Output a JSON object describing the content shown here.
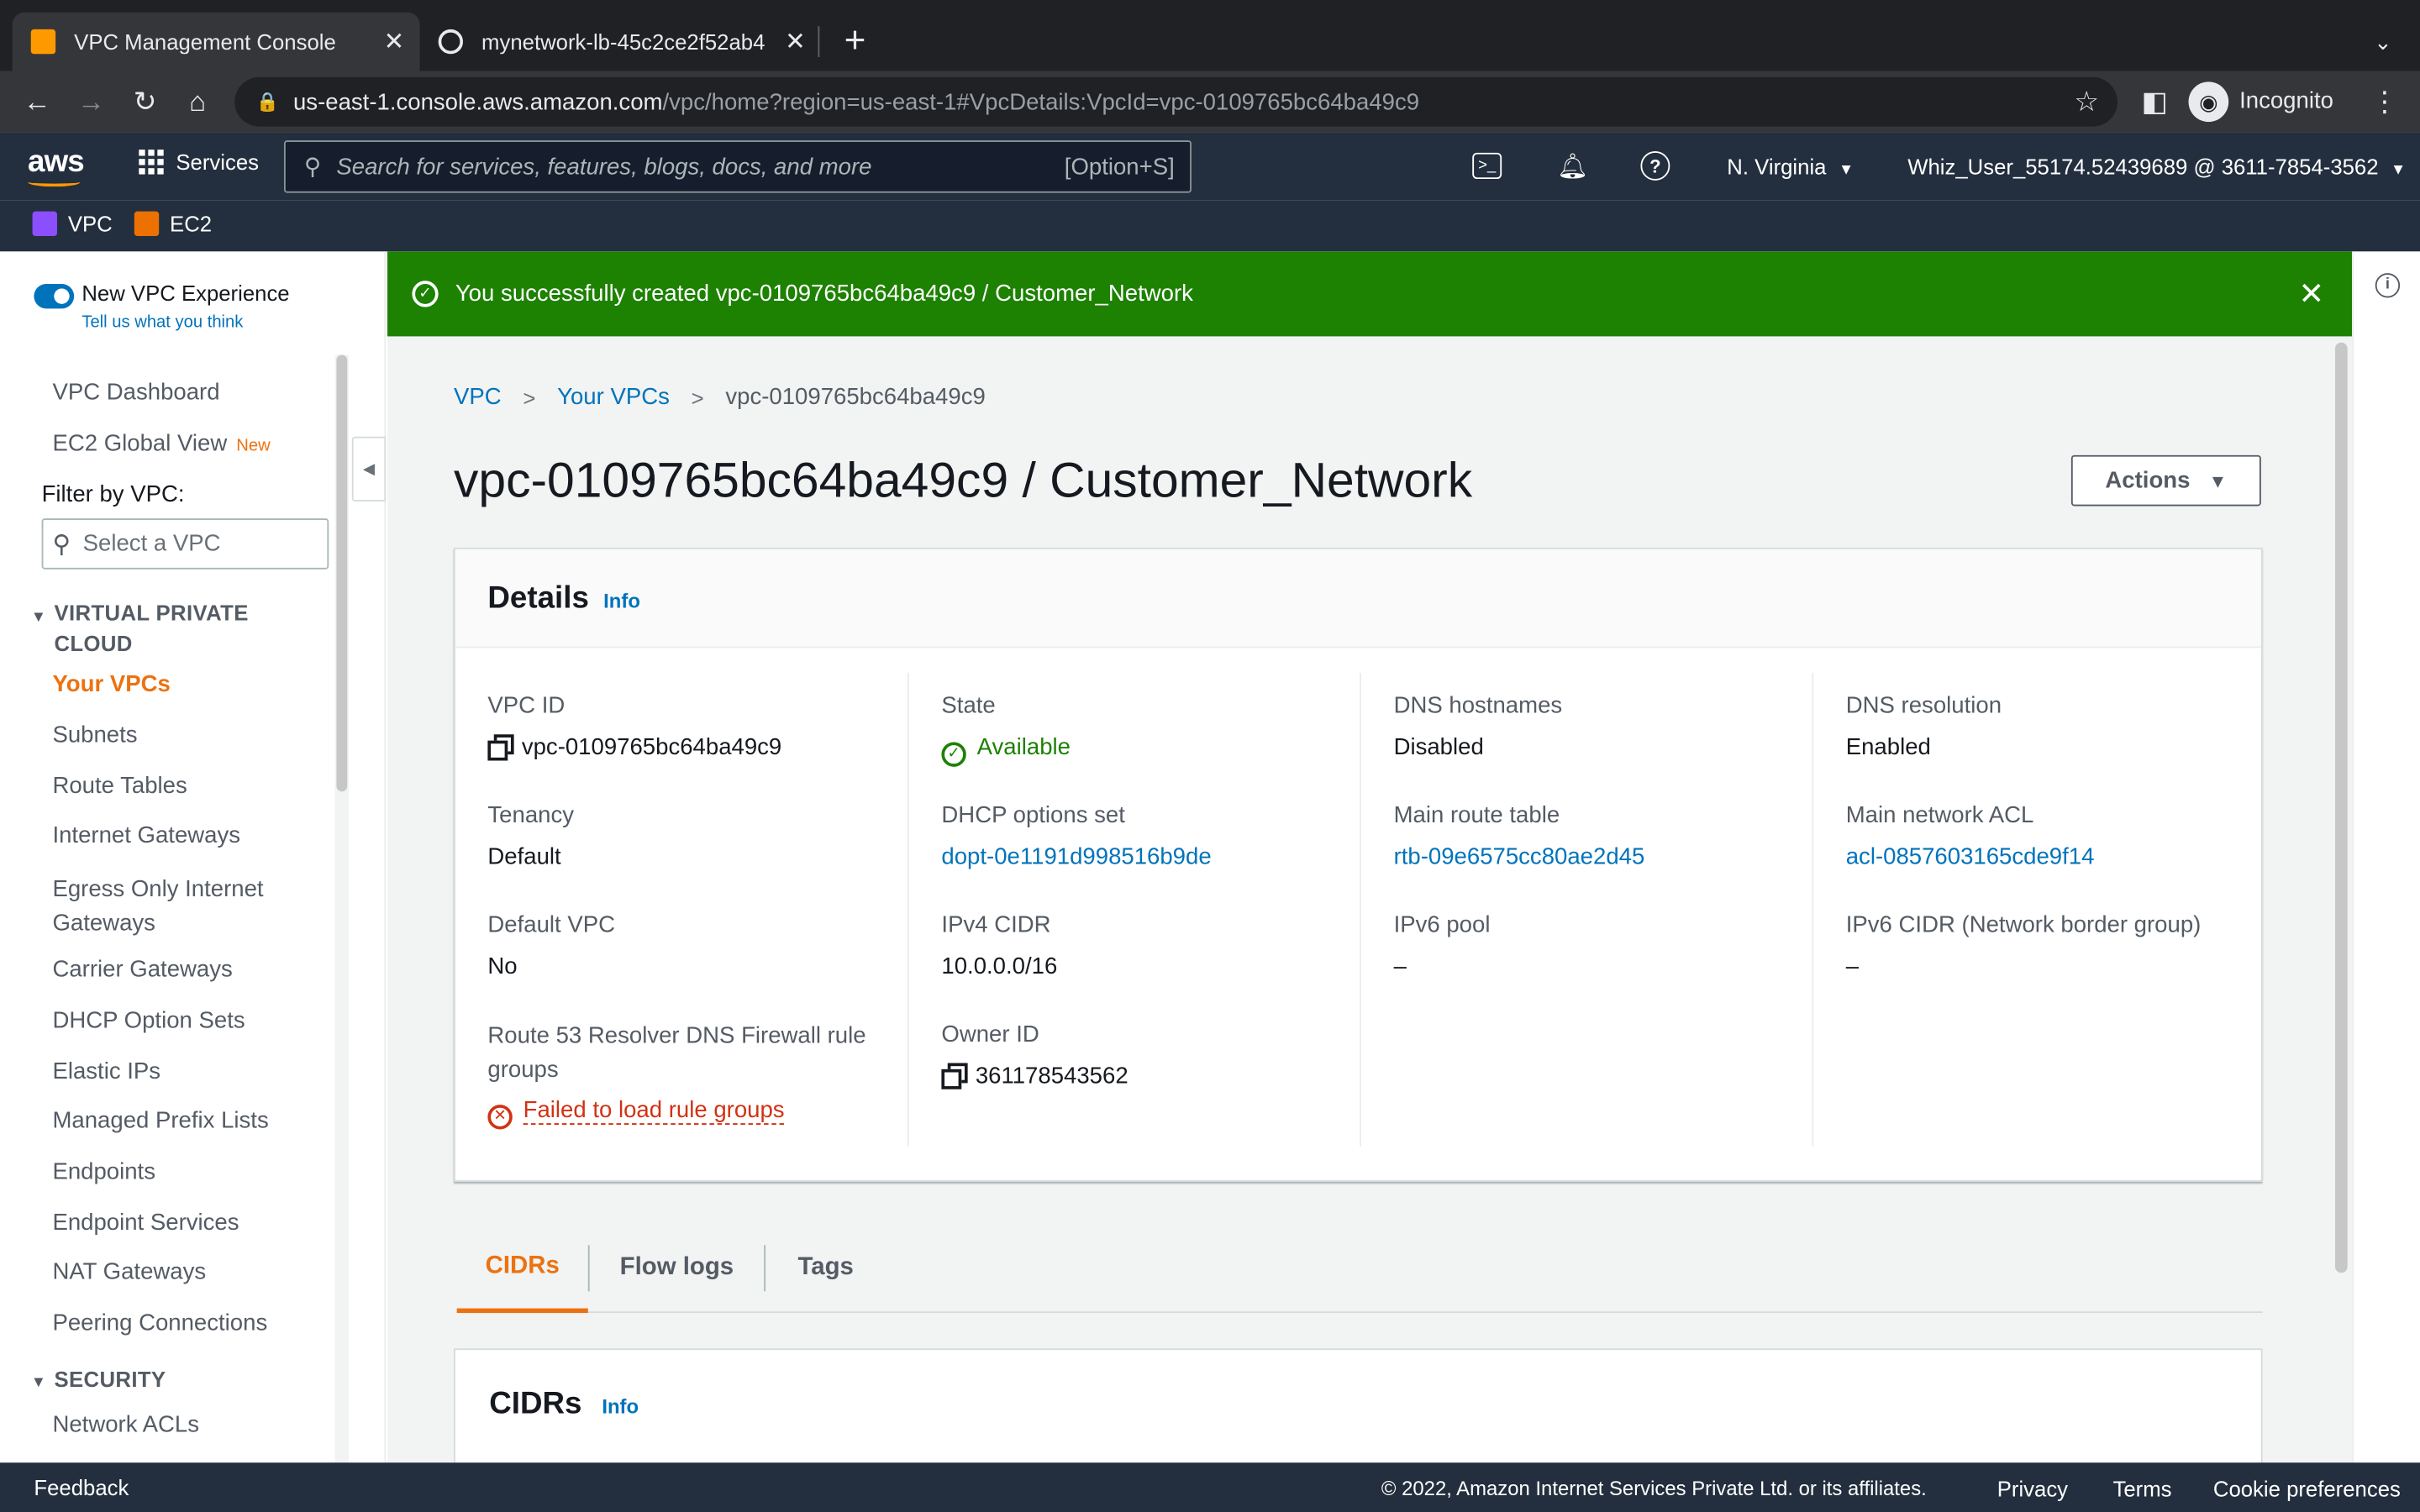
{
  "browser": {
    "tabs": [
      {
        "title": "VPC Management Console",
        "active": true
      },
      {
        "title": "mynetwork-lb-45c2ce2f52ab4",
        "active": false
      }
    ],
    "new_tab": "+",
    "url_host": "us-east-1.console.aws.amazon.com",
    "url_path": "/vpc/home?region=us-east-1#VpcDetails:VpcId=vpc-0109765bc64ba49c9",
    "profile_label": "Incognito"
  },
  "aws_nav": {
    "logo": "aws",
    "services_label": "Services",
    "search_placeholder": "Search for services, features, blogs, docs, and more",
    "search_shortcut": "[Option+S]",
    "region": "N. Virginia",
    "account": "Whiz_User_55174.52439689 @ 3611-7854-3562"
  },
  "favorites": [
    {
      "label": "VPC",
      "color": "#8c4fff"
    },
    {
      "label": "EC2",
      "color": "#ed7100"
    }
  ],
  "sidebar": {
    "new_experience_label": "New VPC Experience",
    "feedback_link": "Tell us what you think",
    "top_items": [
      {
        "label": "VPC Dashboard"
      },
      {
        "label": "EC2 Global View",
        "badge": "New"
      }
    ],
    "filter_label": "Filter by VPC:",
    "filter_placeholder": "Select a VPC",
    "section_vpc": "VIRTUAL PRIVATE CLOUD",
    "vpc_items": [
      {
        "label": "Your VPCs",
        "active": true
      },
      {
        "label": "Subnets"
      },
      {
        "label": "Route Tables"
      },
      {
        "label": "Internet Gateways"
      },
      {
        "label": "Egress Only Internet Gateways"
      },
      {
        "label": "Carrier Gateways"
      },
      {
        "label": "DHCP Option Sets"
      },
      {
        "label": "Elastic IPs"
      },
      {
        "label": "Managed Prefix Lists"
      },
      {
        "label": "Endpoints"
      },
      {
        "label": "Endpoint Services"
      },
      {
        "label": "NAT Gateways"
      },
      {
        "label": "Peering Connections"
      }
    ],
    "section_security": "SECURITY",
    "security_items": [
      {
        "label": "Network ACLs"
      }
    ]
  },
  "banner": {
    "message": "You successfully created vpc-0109765bc64ba49c9 / Customer_Network",
    "color": "#1d8102"
  },
  "breadcrumb": [
    "VPC",
    "Your VPCs",
    "vpc-0109765bc64ba49c9"
  ],
  "page_title": "vpc-0109765bc64ba49c9 / Customer_Network",
  "actions_label": "Actions",
  "details": {
    "title": "Details",
    "info": "Info",
    "columns": [
      [
        {
          "label": "VPC ID",
          "value": "vpc-0109765bc64ba49c9",
          "kind": "copy"
        },
        {
          "label": "Tenancy",
          "value": "Default",
          "kind": "text"
        },
        {
          "label": "Default VPC",
          "value": "No",
          "kind": "text"
        },
        {
          "label": "Route 53 Resolver DNS Firewall rule groups",
          "value": "Failed to load rule groups",
          "kind": "error"
        }
      ],
      [
        {
          "label": "State",
          "value": "Available",
          "kind": "status"
        },
        {
          "label": "DHCP options set",
          "value": "dopt-0e1191d998516b9de",
          "kind": "link"
        },
        {
          "label": "IPv4 CIDR",
          "value": "10.0.0.0/16",
          "kind": "text"
        },
        {
          "label": "Owner ID",
          "value": "361178543562",
          "kind": "copy"
        }
      ],
      [
        {
          "label": "DNS hostnames",
          "value": "Disabled",
          "kind": "text"
        },
        {
          "label": "Main route table",
          "value": "rtb-09e6575cc80ae2d45",
          "kind": "link"
        },
        {
          "label": "IPv6 pool",
          "value": "–",
          "kind": "text"
        }
      ],
      [
        {
          "label": "DNS resolution",
          "value": "Enabled",
          "kind": "text"
        },
        {
          "label": "Main network ACL",
          "value": "acl-0857603165cde9f14",
          "kind": "link"
        },
        {
          "label": "IPv6 CIDR (Network border group)",
          "value": "–",
          "kind": "text"
        }
      ]
    ]
  },
  "tabs": [
    {
      "label": "CIDRs",
      "active": true
    },
    {
      "label": "Flow logs"
    },
    {
      "label": "Tags"
    }
  ],
  "cidrs_panel": {
    "title": "CIDRs",
    "info": "Info"
  },
  "footer": {
    "feedback": "Feedback",
    "copyright": "© 2022, Amazon Internet Services Private Ltd. or its affiliates.",
    "links": [
      "Privacy",
      "Terms",
      "Cookie preferences"
    ]
  },
  "icons": {
    "incognito": "incognito-icon",
    "cloudshell": "cloudshell-icon",
    "notifications": "bell-icon",
    "help": "help-icon"
  }
}
